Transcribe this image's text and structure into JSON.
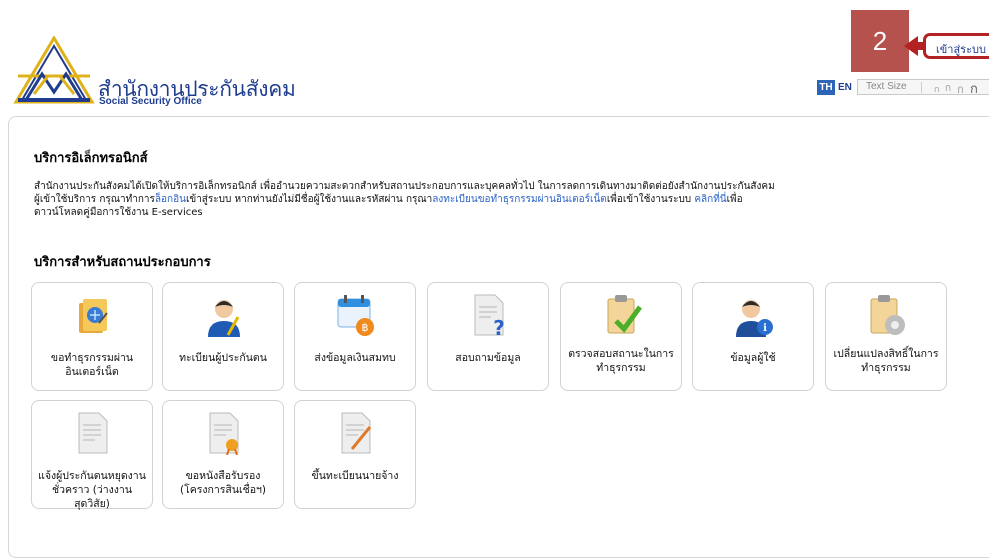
{
  "header": {
    "brand_th": "สำนักงานประกันสังคม",
    "brand_en": "Social Security Office",
    "step_badge": "2",
    "login_label": "เข้าสู่ระบบ",
    "lang_th": "TH",
    "lang_en": "EN",
    "text_size_label": "Text Size",
    "text_size_glyphs": [
      "ก",
      "ก",
      "ก",
      "ก"
    ]
  },
  "main": {
    "heading": "บริการอิเล็กทรอนิกส์",
    "intro": {
      "p1": "สำนักงานประกันสังคมได้เปิดให้บริการอิเล็กทรอนิกส์ เพื่ออำนวยความสะดวกสำหรับสถานประกอบการและบุคคลทั่วไป ในการลดการเดินทางมาติดต่อยังสำนักงานประกันสังคม",
      "p2a": "ผู้เข้าใช้บริการ กรุณาทำการ",
      "link_login": "ล็อกอิน",
      "p2b": "เข้าสู่ระบบ หากท่านยังไม่มีชื่อผู้ใช้งานและรหัสผ่าน กรุณา",
      "link_register": "ลงทะเบียนขอทำธุรกรรมผ่านอินเตอร์เน็ต",
      "p2c": "เพื่อเข้าใช้งานระบบ ",
      "link_here": "คลิกที่นี่",
      "p2d": "เพื่อ",
      "p3": "ดาวน์โหลดคู่มือการใช้งาน E-services"
    },
    "subheading": "บริการสำหรับสถานประกอบการ",
    "tiles": [
      {
        "label": "ขอทำธุรกรรมผ่านอินเตอร์เน็ต",
        "icon": "folder-book-icon"
      },
      {
        "label": "ทะเบียนผู้ประกันตน",
        "icon": "person-pen-icon"
      },
      {
        "label": "ส่งข้อมูลเงินสมทบ",
        "icon": "calendar-baht-icon"
      },
      {
        "label": "สอบถามข้อมูล",
        "icon": "document-question-icon"
      },
      {
        "label": "ตรวจสอบสถานะในการทำธุรกรรม",
        "icon": "clipboard-check-icon"
      },
      {
        "label": "ข้อมูลผู้ใช้",
        "icon": "user-info-icon"
      },
      {
        "label": "เปลี่ยนแปลงสิทธิ์ในการทำธุรกรรม",
        "icon": "clipboard-gear-icon"
      },
      {
        "label": "แจ้งผู้ประกันตนหยุดงานชั่วคราว (ว่างงานสุดวิสัย)",
        "icon": "document-icon"
      },
      {
        "label": "ขอหนังสือรับรอง (โครงการสินเชื่อฯ)",
        "icon": "certificate-document-icon"
      },
      {
        "label": "ขึ้นทะเบียนนายจ้าง",
        "icon": "document-pencil-icon"
      }
    ]
  },
  "colors": {
    "brand_blue": "#1f3c8f",
    "link_blue": "#2a62c8",
    "badge_red": "#b5524e",
    "login_border": "#b22222"
  }
}
